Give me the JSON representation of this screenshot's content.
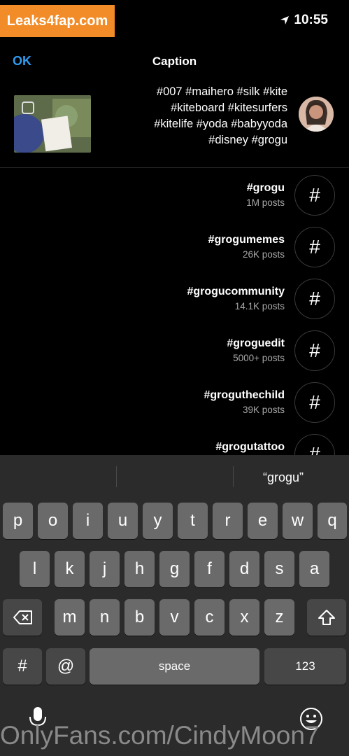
{
  "watermark": {
    "logo_text": "Leaks4fap.com",
    "bottom_text": "OnlyFans.com/CindyMoon7"
  },
  "status_bar": {
    "time": "10:55"
  },
  "header": {
    "title": "Caption",
    "ok_label": "OK"
  },
  "caption": {
    "lines": [
      "#007 #maihero #silk #kite",
      "#kiteboard #kitesurfers",
      "#kitelife #yoda #babyyoda",
      "#disney #grogu"
    ]
  },
  "hashtags": [
    {
      "tag": "#grogu",
      "posts": "1M posts"
    },
    {
      "tag": "#grogumemes",
      "posts": "26K posts"
    },
    {
      "tag": "#grogucommunity",
      "posts": "14.1K posts"
    },
    {
      "tag": "#groguedit",
      "posts": "5000+ posts"
    },
    {
      "tag": "#groguthechild",
      "posts": "39K posts"
    },
    {
      "tag": "#grogutattoo",
      "posts": ""
    }
  ],
  "hash_symbol": "#",
  "keyboard": {
    "suggestion": "“grogu”",
    "row1": [
      "q",
      "w",
      "e",
      "r",
      "t",
      "y",
      "u",
      "i",
      "o",
      "p"
    ],
    "row2": [
      "a",
      "s",
      "d",
      "f",
      "g",
      "h",
      "j",
      "k",
      "l"
    ],
    "row3": [
      "z",
      "x",
      "c",
      "v",
      "b",
      "n",
      "m"
    ],
    "space_label": "space",
    "num_label": "123",
    "hash_key": "#",
    "at_key": "@"
  },
  "colors": {
    "accent": "#2f9bf0",
    "logo_bg": "#f28c28",
    "key": "#6a6a6a",
    "keyboard_bg": "#2b2b2b"
  }
}
